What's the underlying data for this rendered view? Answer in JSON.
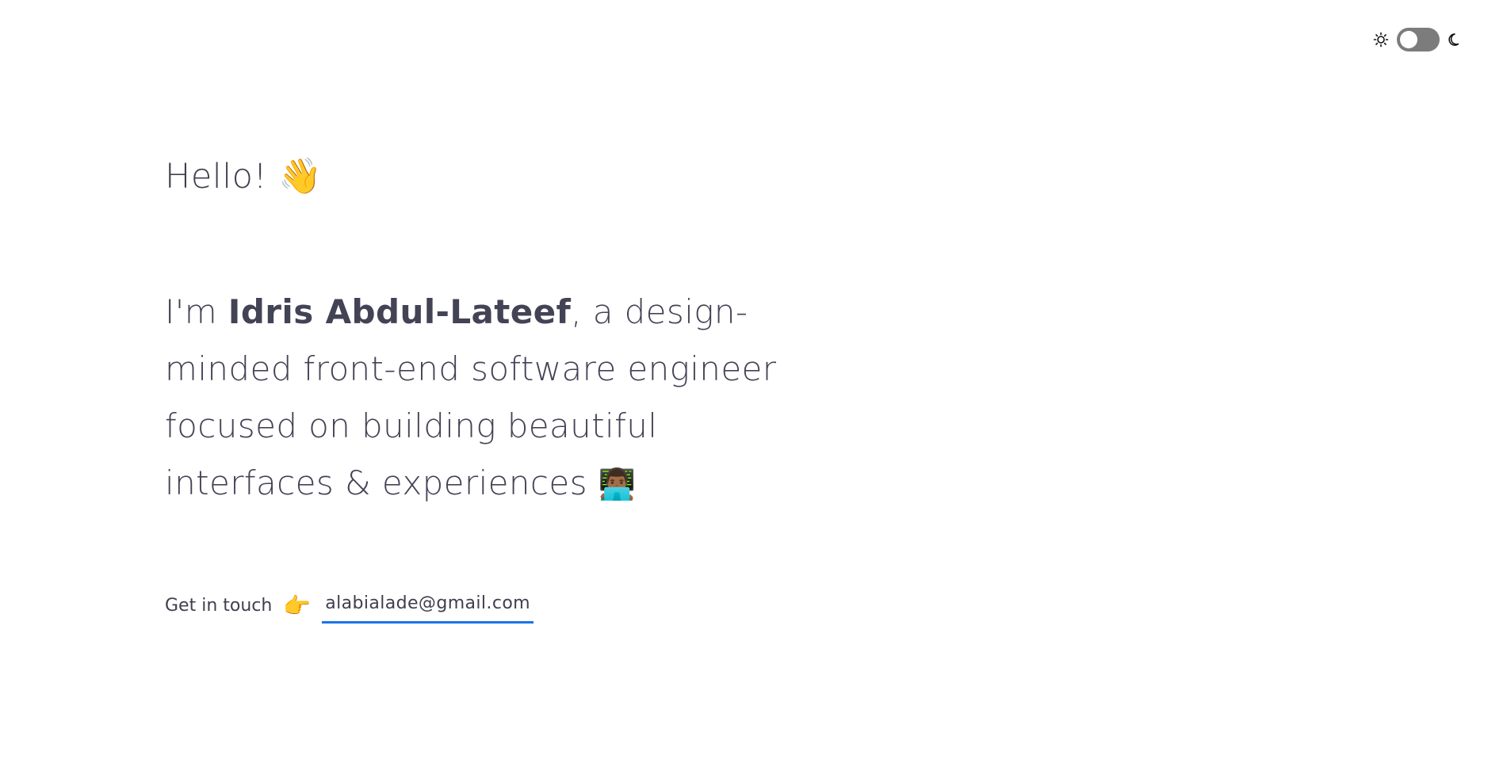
{
  "theme_toggle": {
    "light_icon": "sun-icon",
    "dark_icon": "moon-icon",
    "state": "off"
  },
  "hero": {
    "greeting": "Hello!",
    "greeting_emoji": "👋",
    "intro_prefix": "I'm ",
    "name": "Idris Abdul-Lateef",
    "intro_suffix": ", a design-minded front-end software engineer focused on building beautiful interfaces & experiences",
    "intro_emoji": "👨🏾‍💻"
  },
  "contact": {
    "label": "Get in touch",
    "pointer_emoji": "👉",
    "email": "alabialade@gmail.com"
  },
  "colors": {
    "text": "#3f3f4f",
    "link_underline": "#1a73e8",
    "toggle_track": "#7c7c7c",
    "background": "#ffffff"
  }
}
